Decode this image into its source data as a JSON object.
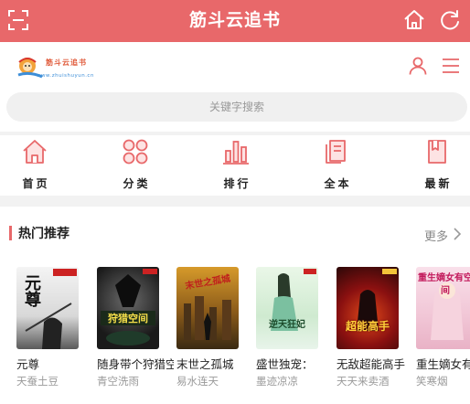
{
  "topbar": {
    "title": "筋斗云追书"
  },
  "header": {
    "logo_text": "筋斗云追书",
    "logo_url": "www.zhuishuyun.cn"
  },
  "search": {
    "placeholder": "关键字搜索"
  },
  "nav": [
    {
      "label": "首页",
      "icon": "home-icon"
    },
    {
      "label": "分类",
      "icon": "category-icon"
    },
    {
      "label": "排行",
      "icon": "ranking-icon"
    },
    {
      "label": "全本",
      "icon": "complete-books-icon"
    },
    {
      "label": "最新",
      "icon": "latest-icon"
    }
  ],
  "hot": {
    "title": "热门推荐",
    "more": "更多",
    "books": [
      {
        "title": "元尊",
        "author": "天蚕土豆",
        "cover_text": "元尊"
      },
      {
        "title": "随身带个狩猎空间",
        "author": "青空洗雨",
        "cover_text": "狩猎空间"
      },
      {
        "title": "末世之孤城",
        "author": "易水连天",
        "cover_text": "末世之孤城"
      },
      {
        "title": "盛世独宠：",
        "author": "墨迹凉凉",
        "cover_text": "逆天狂妃"
      },
      {
        "title": "无敌超能高手",
        "author": "天天来卖酒",
        "cover_text": "超能高手"
      },
      {
        "title": "重生嫡女有空间",
        "author": "笑寒烟",
        "cover_text": "重生嫡女有空间"
      }
    ]
  },
  "colors": {
    "brand": "#e8686a",
    "muted": "#999999"
  }
}
